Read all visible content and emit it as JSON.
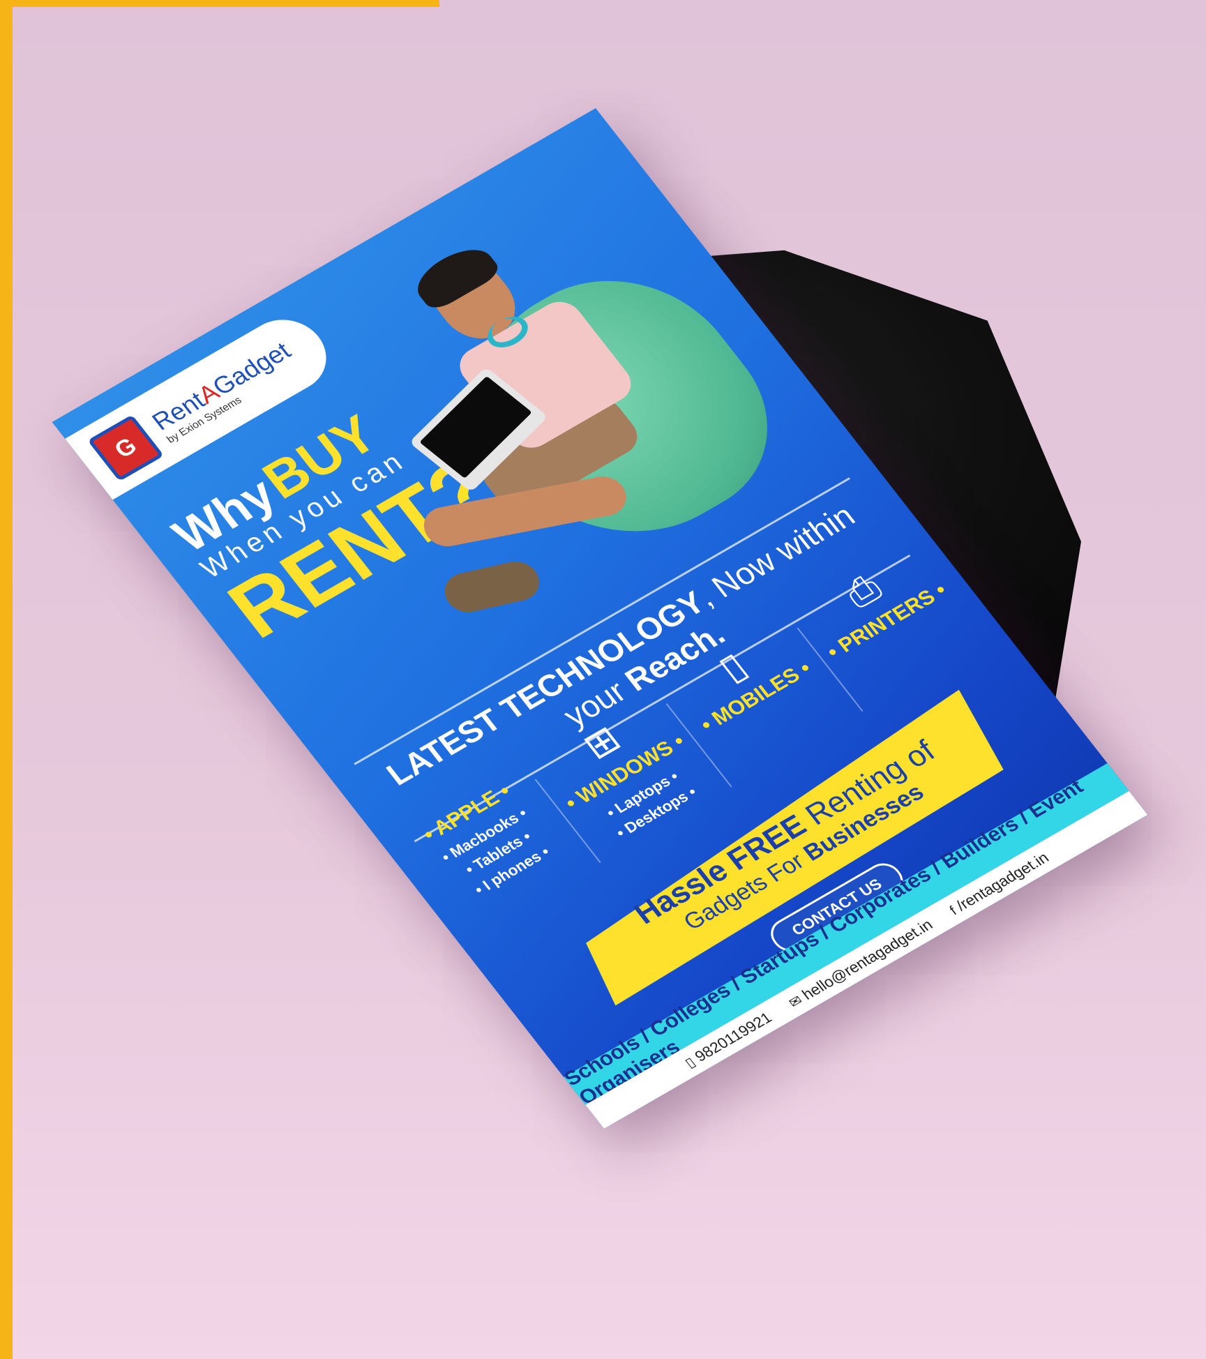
{
  "logo": {
    "name_part1": "Rent",
    "name_part2": "A",
    "name_part3": "Gadget",
    "sub": "by Exion Systems"
  },
  "headline": {
    "why": "Why",
    "buy": "BUY",
    "when": "When you can",
    "rent": "RENT?"
  },
  "tagline": {
    "bold": "LATEST TECHNOLOGY",
    "middle": ", Now within your ",
    "end": "Reach."
  },
  "categories": [
    {
      "icon": "apple-icon",
      "glyph": "",
      "title": "• APPLE •",
      "items": [
        "• Macbooks •",
        "• Tablets •",
        "• I phones •"
      ]
    },
    {
      "icon": "windows-icon",
      "glyph": "⊞",
      "title": "• WINDOWS •",
      "items": [
        "• Laptops •",
        "• Desktops •"
      ]
    },
    {
      "icon": "mobile-icon",
      "glyph": "▯",
      "title": "• MOBILES •",
      "items": []
    },
    {
      "icon": "printer-icon",
      "glyph": "⎙",
      "title": "• PRINTERS •",
      "items": []
    }
  ],
  "promo": {
    "hassle": "Hassle ",
    "free": "FREE",
    "renting": " Renting of",
    "gadgets": "Gadgets For ",
    "businesses": "Businesses"
  },
  "contact_label": "CONTACT US",
  "audience": "Schools / Colleges / Startups / Corporates / Builders / Event Organisers",
  "footer": {
    "phone_icon": "phone-icon",
    "phone": "9820119921",
    "email_icon": "mail-icon",
    "email": "hello@rentagadget.in",
    "fb_icon": "facebook-icon",
    "fb": "/rentagadget.in"
  },
  "colors": {
    "frame": "#f6b416",
    "background": "#e0c3d8",
    "flyer_blue": "#1f6fe0",
    "accent_yellow": "#fde12d",
    "cyan_band": "#33d6e6"
  }
}
